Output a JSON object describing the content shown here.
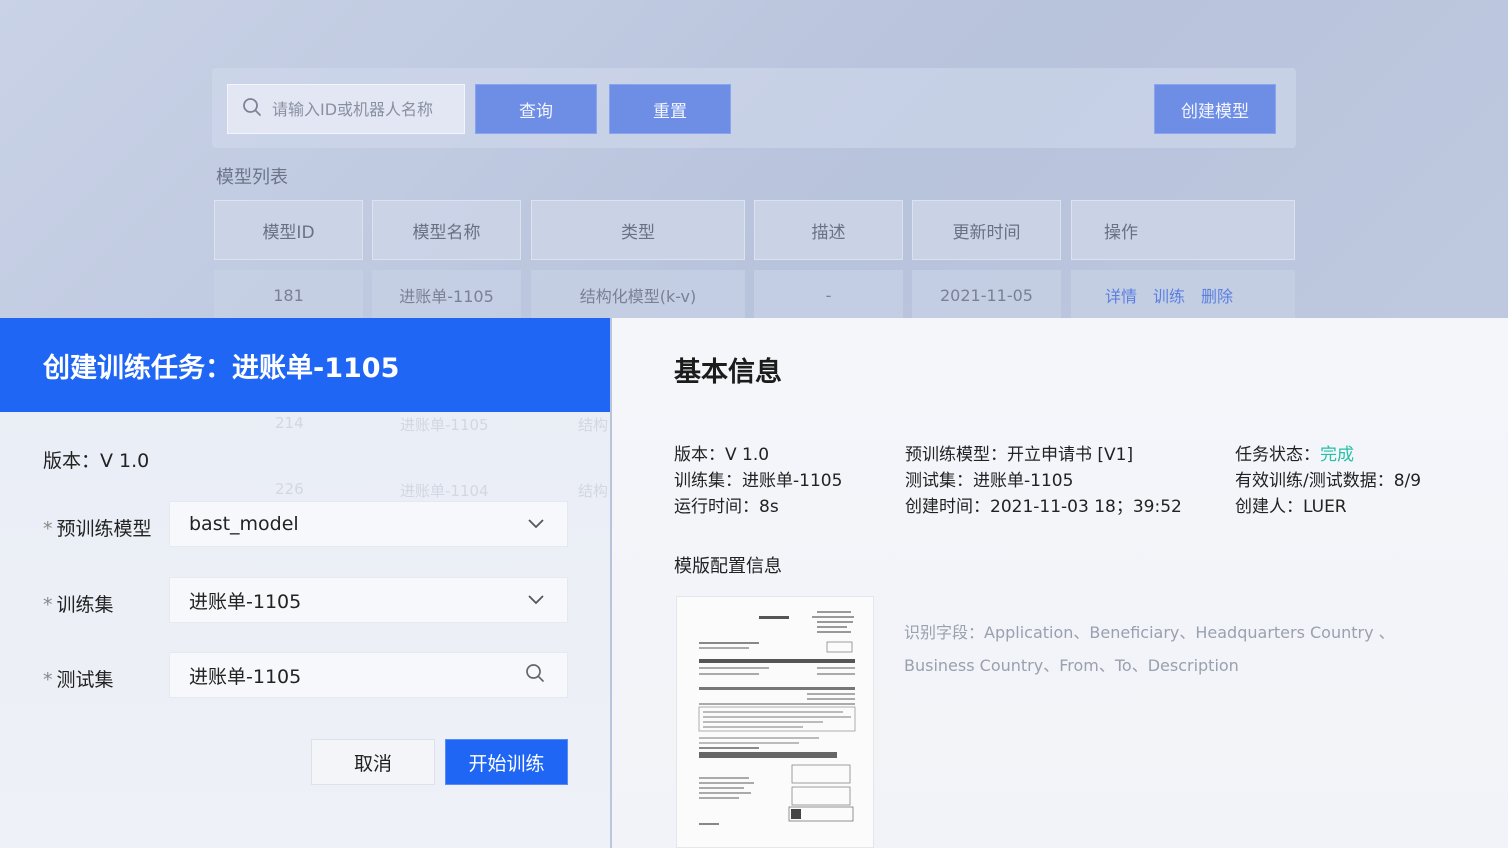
{
  "list_page": {
    "search_placeholder": "请输入ID或机器人名称",
    "query_button": "查询",
    "reset_button": "重置",
    "create_model_button": "创建模型",
    "list_title": "模型列表",
    "columns": [
      "模型ID",
      "模型名称",
      "类型",
      "描述",
      "更新时间",
      "操作"
    ],
    "rows": [
      {
        "id": "181",
        "name": "进账单-1105",
        "type": "结构化模型(k-v)",
        "desc": "-",
        "updated": "2021-11-05",
        "ops": [
          "详情",
          "训练",
          "删除"
        ]
      }
    ],
    "ghost_rows": [
      {
        "id": "214",
        "name": "进账单-1105",
        "type": "结构"
      },
      {
        "id": "226",
        "name": "进账单-1104",
        "type": "结构"
      }
    ]
  },
  "modal": {
    "title": "创建训练任务：进账单-1105",
    "version": "版本：V 1.0",
    "star": "*",
    "fields": [
      {
        "label": "预训练模型",
        "value": "bast_model",
        "icon": "chevron-down-icon"
      },
      {
        "label": "训练集",
        "value": "进账单-1105",
        "icon": "chevron-down-icon"
      },
      {
        "label": "测试集",
        "value": "进账单-1105",
        "icon": "search-icon"
      }
    ],
    "cancel_button": "取消",
    "start_button": "开始训练"
  },
  "info": {
    "title": "基本信息",
    "col1": [
      "版本：V 1.0",
      "训练集：进账单-1105",
      "运行时间：8s"
    ],
    "col2": [
      "预训练模型：开立申请书 [V1]",
      "测试集：进账单-1105",
      "创建时间：2021-11-03 18；39:52"
    ],
    "status_label": "任务状态：",
    "status_value": "完成",
    "valid_data": "有效训练/测试数据：8/9",
    "creator": "创建人：LUER",
    "template_title": "模版配置信息",
    "fields_line1": "识别字段：Application、Beneficiary、Headquarters Country 、",
    "fields_line2": "Business Country、From、To、Description"
  },
  "colors": {
    "primary": "#1f66f5",
    "muted_blue": "#6e8ee6",
    "status_done": "#27c0a7"
  }
}
